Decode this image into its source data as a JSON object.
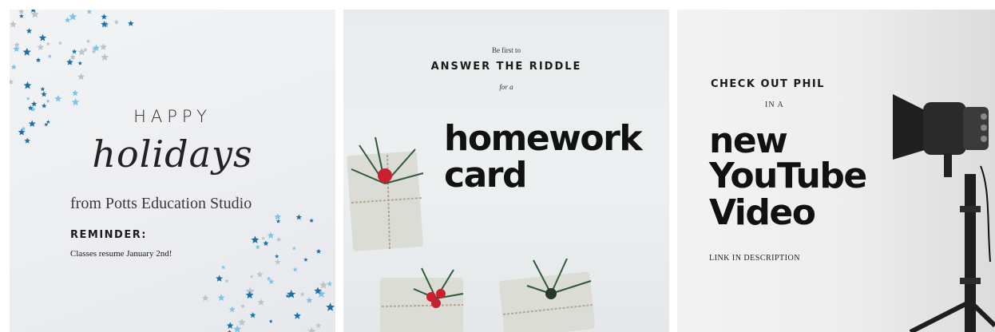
{
  "cards": [
    {
      "happy": "HAPPY",
      "holidays": "holidays",
      "from": "from Potts Education Studio",
      "reminder_label": "REMINDER:",
      "reminder_text": "Classes resume January 2nd!"
    },
    {
      "intro": "Be first to",
      "headline": "ANSWER THE RIDDLE",
      "connector": "for a",
      "title_line1": "homework",
      "title_line2": "card"
    },
    {
      "headline": "CHECK OUT PHIL",
      "connector": "IN A",
      "title_line1": "new",
      "title_line2": "YouTube",
      "title_line3": "Video",
      "footer": "LINK IN DESCRIPTION"
    }
  ],
  "colors": {
    "confetti_dark": "#1d6fa5",
    "confetti_light": "#7fc3e6",
    "confetti_silver": "#b9c4cc",
    "text_dark": "#111111"
  },
  "icons": [
    "star-confetti",
    "gift-box",
    "pine-sprig",
    "red-berry",
    "studio-light"
  ]
}
